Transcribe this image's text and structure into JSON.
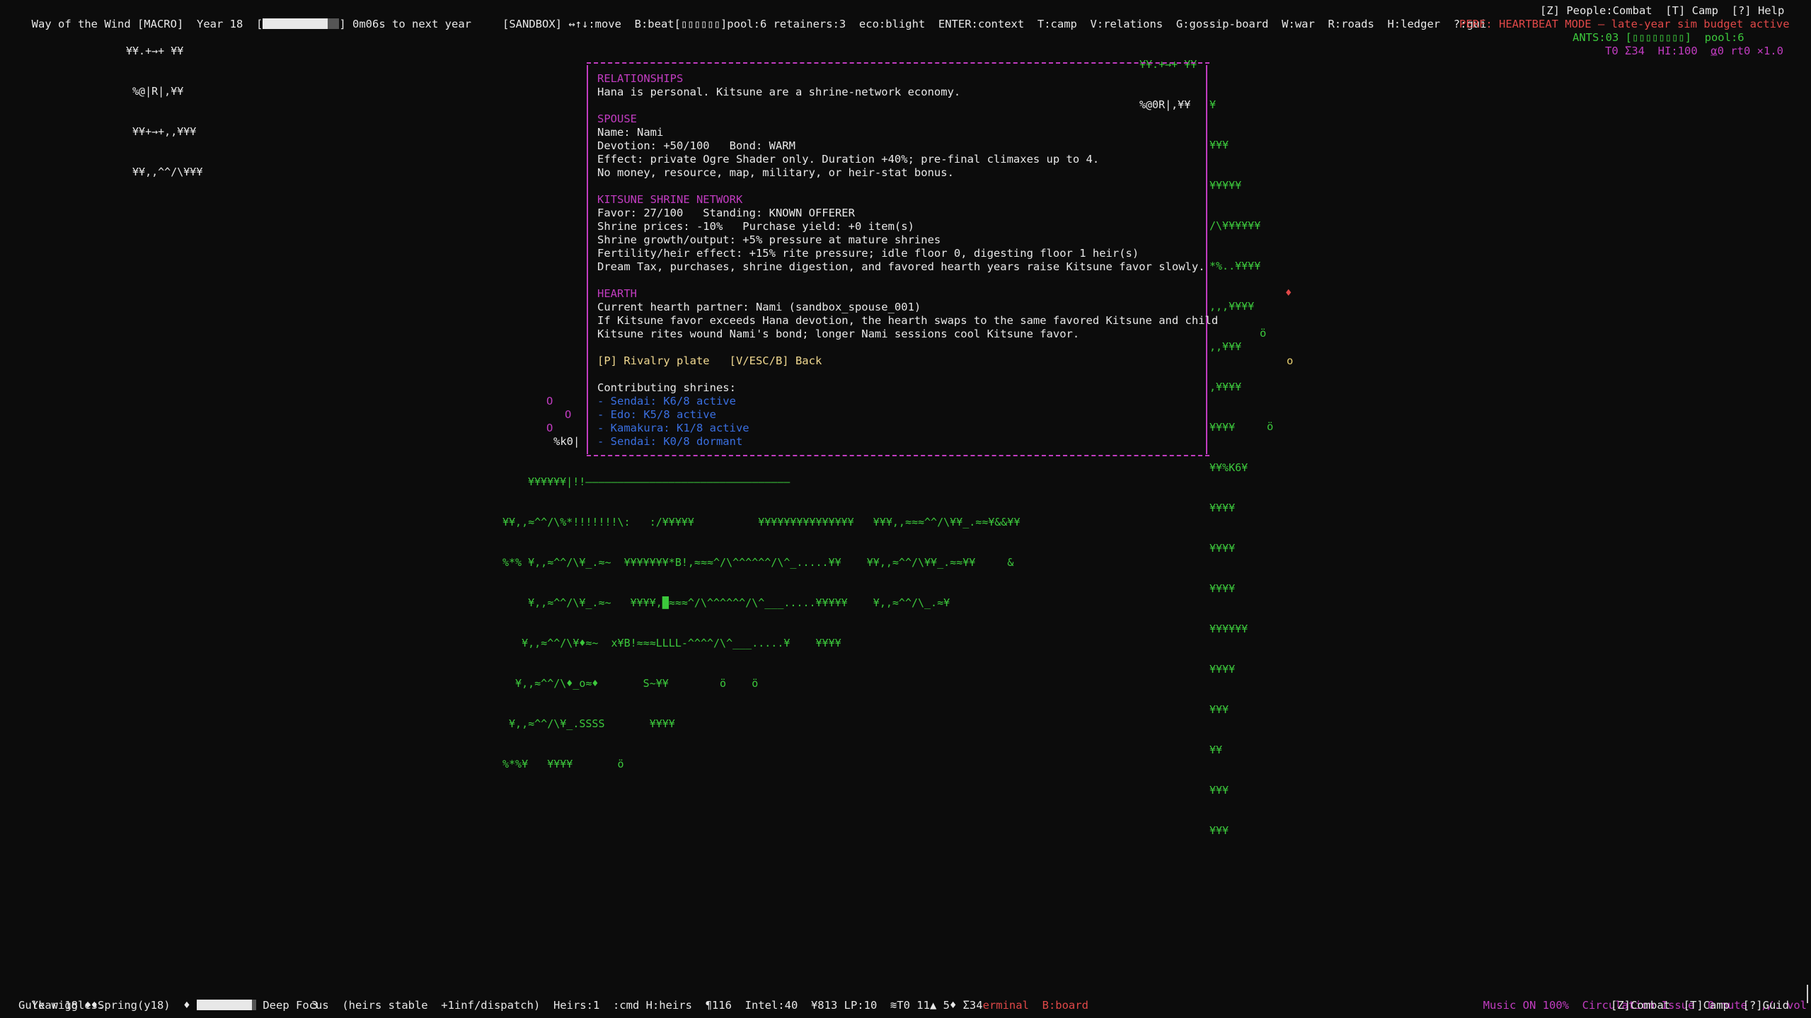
{
  "header": {
    "title": "Way of the Wind [MACRO]",
    "year_label": "Year 18",
    "timer_bracket_open": "[",
    "timer_bracket_close": "]",
    "timer_text": "0m06s to next year",
    "keys_line": "[SANDBOX] ↔↑↓:move  B:beat[▯▯▯▯▯▯]pool:6 retainers:3  eco:blight  ENTER:context  T:camp  V:relations  G:gossip-board  W:war  R:roads  H:ledger  ?:gui",
    "perf_text": "PERF: HEARTBEAT MODE — late-year sim budget active",
    "top_right_menu": "[Z] People:Combat  [T] Camp  [?] Help",
    "ants_line": "ANTS:03 [▯▯▯▯▯▯▯▯]  pool:6",
    "stats_line": "T0 Σ34  HI:100  ⍶0 rt0 ×1.0"
  },
  "panel": {
    "relationships_heading": "RELATIONSHIPS",
    "relationships_intro": "Hana is personal. Kitsune are a shrine-network economy.",
    "spouse_heading": "SPOUSE",
    "spouse_name": "Name: Nami",
    "spouse_devotion": "Devotion: +50/100   Bond: WARM",
    "spouse_effect": "Effect: private Ogre Shader only. Duration +40%; pre-final climaxes up to 4.",
    "spouse_note": "No money, resource, map, military, or heir-stat bonus.",
    "kitsune_heading": "KITSUNE SHRINE NETWORK",
    "kitsune_favor": "Favor: 27/100   Standing: KNOWN OFFERER",
    "kitsune_prices": "Shrine prices: -10%   Purchase yield: +0 item(s)",
    "kitsune_growth": "Shrine growth/output: +5% pressure at mature shrines",
    "kitsune_fertility": "Fertility/heir effect: +15% rite pressure; idle floor 0, digesting floor 1 heir(s)",
    "kitsune_dream": "Dream Tax, purchases, shrine digestion, and favored hearth years raise Kitsune favor slowly.",
    "hearth_heading": "HEARTH",
    "hearth_partner": "Current hearth partner: Nami (sandbox_spouse_001)",
    "hearth_swap": "If Kitsune favor exceeds Hana devotion, the hearth swaps to the same favored Kitsune and child",
    "hearth_wound": "Kitsune rites wound Nami's bond; longer Nami sessions cool Kitsune favor.",
    "action_rivalry": "[P] Rivalry plate",
    "action_back": "[V/ESC/B] Back",
    "contrib_heading": "Contributing shrines:",
    "shrines": [
      "- Sendai: K6/8 active",
      "- Edo: K5/8 active",
      "- Kamakura: K1/8 active",
      "- Sendai: K0/8 dormant"
    ]
  },
  "map_art": {
    "topleft": [
      "¥¥.+→+ ¥¥",
      " %@|R|,¥¥",
      " ¥¥+→+,,¥¥¥",
      " ¥¥,,^^/\\¥¥¥"
    ],
    "topcenter": [
      "¥¥.+→+ ¥¥",
      "%@0R|,¥¥"
    ],
    "right_column": [
      "¥",
      "¥¥¥",
      "¥¥¥¥¥",
      "/\\¥¥¥¥¥¥",
      "*%..¥¥¥¥",
      ",,,¥¥¥¥",
      ",,¥¥¥",
      ",¥¥¥¥",
      "¥¥¥¥",
      "¥¥%K6¥",
      "¥¥¥¥",
      "¥¥¥¥",
      "¥¥¥¥",
      "¥¥¥¥¥¥",
      "¥¥¥¥",
      "¥¥¥",
      "¥¥",
      "¥¥¥",
      "¥¥¥"
    ],
    "left_markers": [
      "O",
      "O",
      "O",
      "%k0|"
    ],
    "bottom": [
      "¥¥¥¥¥¥|!!————————————————————————————————",
      "¥¥,,≈^^/\\%*!!!!!!!\\:   :/¥¥¥¥¥          ¥¥¥¥¥¥¥¥¥¥¥¥¥¥¥   ¥¥¥,,≈≈≈^^/\\¥¥_.≈≈¥&&¥¥",
      "%*% ¥,,≈^^/\\¥_.≈~  ¥¥¥¥¥¥¥*B!,≈≈≈^/\\^^^^^^/\\^_.....¥¥    ¥¥,,≈^^/\\¥¥_.≈≈¥¥     &",
      "    ¥,,≈^^/\\¥_.≈~   ¥¥¥¥,█≈≈≈^/\\^^^^^^/\\^___.....¥¥¥¥¥    ¥,,≈^^/\\_.≈¥",
      "   ¥,,≈^^/\\¥♦≈~  x¥B!≈≈≈LLLL-^^^^/\\^___.....¥    ¥¥¥¥",
      "  ¥,,≈^^/\\♦_o≈♦       S~¥¥        ö    ö",
      " ¥,,≈^^/\\¥_.SSSS       ¥¥¥¥",
      "%*%¥   ¥¥¥¥       ö"
    ],
    "scatter_markers": [
      "♦",
      "ö",
      "o",
      "ö"
    ]
  },
  "footer": {
    "year_season": "Year 18 ♦♦Spring(y18)  ♦",
    "focus_label": "Deep Focus",
    "heirs_status": "(heirs stable  +1inf/dispatch)",
    "heirs_count": "Heirs:1",
    "cmd_hint": ":cmd H:heirs",
    "paragraphs": "¶116",
    "intel": "Intel:40",
    "money_lp": "¥813 LP:10",
    "counts": "≋T0 11▲ 5♦ Σ34",
    "terminal_label": "erminal",
    "board_label": "B:board",
    "music": "Music ON 100%",
    "circulation": "Circulation Issue",
    "mute": "0 mute",
    "vol": ",/. vol",
    "message": "Gulk wiggles.",
    "message_count": "3",
    "bottom_right_menu": "[Z]Combat  [T]Camp  [?]Guid"
  },
  "colors": {
    "background": "#0c0c0c",
    "text": "#cccccc",
    "magenta": "#c13cc0",
    "green": "#3cc83c",
    "red": "#e04848",
    "blue": "#3a6fe0",
    "yellow": "#f0d890"
  }
}
